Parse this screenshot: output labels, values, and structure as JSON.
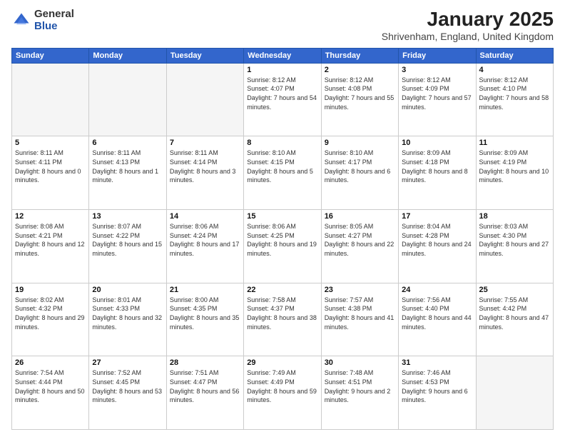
{
  "logo": {
    "general": "General",
    "blue": "Blue"
  },
  "title": "January 2025",
  "location": "Shrivenham, England, United Kingdom",
  "days_of_week": [
    "Sunday",
    "Monday",
    "Tuesday",
    "Wednesday",
    "Thursday",
    "Friday",
    "Saturday"
  ],
  "weeks": [
    [
      {
        "day": "",
        "sunrise": "",
        "sunset": "",
        "daylight": "",
        "empty": true
      },
      {
        "day": "",
        "sunrise": "",
        "sunset": "",
        "daylight": "",
        "empty": true
      },
      {
        "day": "",
        "sunrise": "",
        "sunset": "",
        "daylight": "",
        "empty": true
      },
      {
        "day": "1",
        "sunrise": "Sunrise: 8:12 AM",
        "sunset": "Sunset: 4:07 PM",
        "daylight": "Daylight: 7 hours and 54 minutes."
      },
      {
        "day": "2",
        "sunrise": "Sunrise: 8:12 AM",
        "sunset": "Sunset: 4:08 PM",
        "daylight": "Daylight: 7 hours and 55 minutes."
      },
      {
        "day": "3",
        "sunrise": "Sunrise: 8:12 AM",
        "sunset": "Sunset: 4:09 PM",
        "daylight": "Daylight: 7 hours and 57 minutes."
      },
      {
        "day": "4",
        "sunrise": "Sunrise: 8:12 AM",
        "sunset": "Sunset: 4:10 PM",
        "daylight": "Daylight: 7 hours and 58 minutes."
      }
    ],
    [
      {
        "day": "5",
        "sunrise": "Sunrise: 8:11 AM",
        "sunset": "Sunset: 4:11 PM",
        "daylight": "Daylight: 8 hours and 0 minutes."
      },
      {
        "day": "6",
        "sunrise": "Sunrise: 8:11 AM",
        "sunset": "Sunset: 4:13 PM",
        "daylight": "Daylight: 8 hours and 1 minute."
      },
      {
        "day": "7",
        "sunrise": "Sunrise: 8:11 AM",
        "sunset": "Sunset: 4:14 PM",
        "daylight": "Daylight: 8 hours and 3 minutes."
      },
      {
        "day": "8",
        "sunrise": "Sunrise: 8:10 AM",
        "sunset": "Sunset: 4:15 PM",
        "daylight": "Daylight: 8 hours and 5 minutes."
      },
      {
        "day": "9",
        "sunrise": "Sunrise: 8:10 AM",
        "sunset": "Sunset: 4:17 PM",
        "daylight": "Daylight: 8 hours and 6 minutes."
      },
      {
        "day": "10",
        "sunrise": "Sunrise: 8:09 AM",
        "sunset": "Sunset: 4:18 PM",
        "daylight": "Daylight: 8 hours and 8 minutes."
      },
      {
        "day": "11",
        "sunrise": "Sunrise: 8:09 AM",
        "sunset": "Sunset: 4:19 PM",
        "daylight": "Daylight: 8 hours and 10 minutes."
      }
    ],
    [
      {
        "day": "12",
        "sunrise": "Sunrise: 8:08 AM",
        "sunset": "Sunset: 4:21 PM",
        "daylight": "Daylight: 8 hours and 12 minutes."
      },
      {
        "day": "13",
        "sunrise": "Sunrise: 8:07 AM",
        "sunset": "Sunset: 4:22 PM",
        "daylight": "Daylight: 8 hours and 15 minutes."
      },
      {
        "day": "14",
        "sunrise": "Sunrise: 8:06 AM",
        "sunset": "Sunset: 4:24 PM",
        "daylight": "Daylight: 8 hours and 17 minutes."
      },
      {
        "day": "15",
        "sunrise": "Sunrise: 8:06 AM",
        "sunset": "Sunset: 4:25 PM",
        "daylight": "Daylight: 8 hours and 19 minutes."
      },
      {
        "day": "16",
        "sunrise": "Sunrise: 8:05 AM",
        "sunset": "Sunset: 4:27 PM",
        "daylight": "Daylight: 8 hours and 22 minutes."
      },
      {
        "day": "17",
        "sunrise": "Sunrise: 8:04 AM",
        "sunset": "Sunset: 4:28 PM",
        "daylight": "Daylight: 8 hours and 24 minutes."
      },
      {
        "day": "18",
        "sunrise": "Sunrise: 8:03 AM",
        "sunset": "Sunset: 4:30 PM",
        "daylight": "Daylight: 8 hours and 27 minutes."
      }
    ],
    [
      {
        "day": "19",
        "sunrise": "Sunrise: 8:02 AM",
        "sunset": "Sunset: 4:32 PM",
        "daylight": "Daylight: 8 hours and 29 minutes."
      },
      {
        "day": "20",
        "sunrise": "Sunrise: 8:01 AM",
        "sunset": "Sunset: 4:33 PM",
        "daylight": "Daylight: 8 hours and 32 minutes."
      },
      {
        "day": "21",
        "sunrise": "Sunrise: 8:00 AM",
        "sunset": "Sunset: 4:35 PM",
        "daylight": "Daylight: 8 hours and 35 minutes."
      },
      {
        "day": "22",
        "sunrise": "Sunrise: 7:58 AM",
        "sunset": "Sunset: 4:37 PM",
        "daylight": "Daylight: 8 hours and 38 minutes."
      },
      {
        "day": "23",
        "sunrise": "Sunrise: 7:57 AM",
        "sunset": "Sunset: 4:38 PM",
        "daylight": "Daylight: 8 hours and 41 minutes."
      },
      {
        "day": "24",
        "sunrise": "Sunrise: 7:56 AM",
        "sunset": "Sunset: 4:40 PM",
        "daylight": "Daylight: 8 hours and 44 minutes."
      },
      {
        "day": "25",
        "sunrise": "Sunrise: 7:55 AM",
        "sunset": "Sunset: 4:42 PM",
        "daylight": "Daylight: 8 hours and 47 minutes."
      }
    ],
    [
      {
        "day": "26",
        "sunrise": "Sunrise: 7:54 AM",
        "sunset": "Sunset: 4:44 PM",
        "daylight": "Daylight: 8 hours and 50 minutes."
      },
      {
        "day": "27",
        "sunrise": "Sunrise: 7:52 AM",
        "sunset": "Sunset: 4:45 PM",
        "daylight": "Daylight: 8 hours and 53 minutes."
      },
      {
        "day": "28",
        "sunrise": "Sunrise: 7:51 AM",
        "sunset": "Sunset: 4:47 PM",
        "daylight": "Daylight: 8 hours and 56 minutes."
      },
      {
        "day": "29",
        "sunrise": "Sunrise: 7:49 AM",
        "sunset": "Sunset: 4:49 PM",
        "daylight": "Daylight: 8 hours and 59 minutes."
      },
      {
        "day": "30",
        "sunrise": "Sunrise: 7:48 AM",
        "sunset": "Sunset: 4:51 PM",
        "daylight": "Daylight: 9 hours and 2 minutes."
      },
      {
        "day": "31",
        "sunrise": "Sunrise: 7:46 AM",
        "sunset": "Sunset: 4:53 PM",
        "daylight": "Daylight: 9 hours and 6 minutes."
      },
      {
        "day": "",
        "sunrise": "",
        "sunset": "",
        "daylight": "",
        "empty": true
      }
    ]
  ]
}
